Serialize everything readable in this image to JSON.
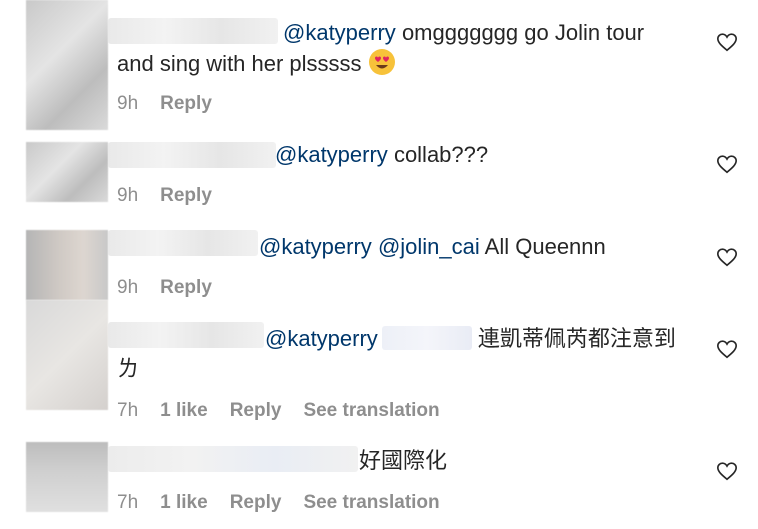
{
  "comments": [
    {
      "mentions": [
        "@katyperry"
      ],
      "text": "omggggggg go Jolin tour and sing with her plsssss",
      "time": "9h",
      "reply": "Reply"
    },
    {
      "mentions": [
        "@katyperry"
      ],
      "text": "collab???",
      "time": "9h",
      "reply": "Reply"
    },
    {
      "mentions": [
        "@katyperry",
        "@jolin_cai"
      ],
      "text": "All Queennn",
      "time": "9h",
      "reply": "Reply"
    },
    {
      "mentions": [
        "@katyperry"
      ],
      "text": "連凱蒂佩芮都注意到ㄌ",
      "time": "7h",
      "likes": "1 like",
      "reply": "Reply",
      "translate": "See translation"
    },
    {
      "text": "好國際化",
      "time": "7h",
      "likes": "1 like",
      "reply": "Reply",
      "translate": "See translation"
    }
  ],
  "icons": {
    "like": "heart-outline-icon",
    "emoji": "heart-eyes-emoji-icon"
  },
  "colors": {
    "mention": "#00376b",
    "meta": "#8e8e8e",
    "text": "#262626"
  }
}
